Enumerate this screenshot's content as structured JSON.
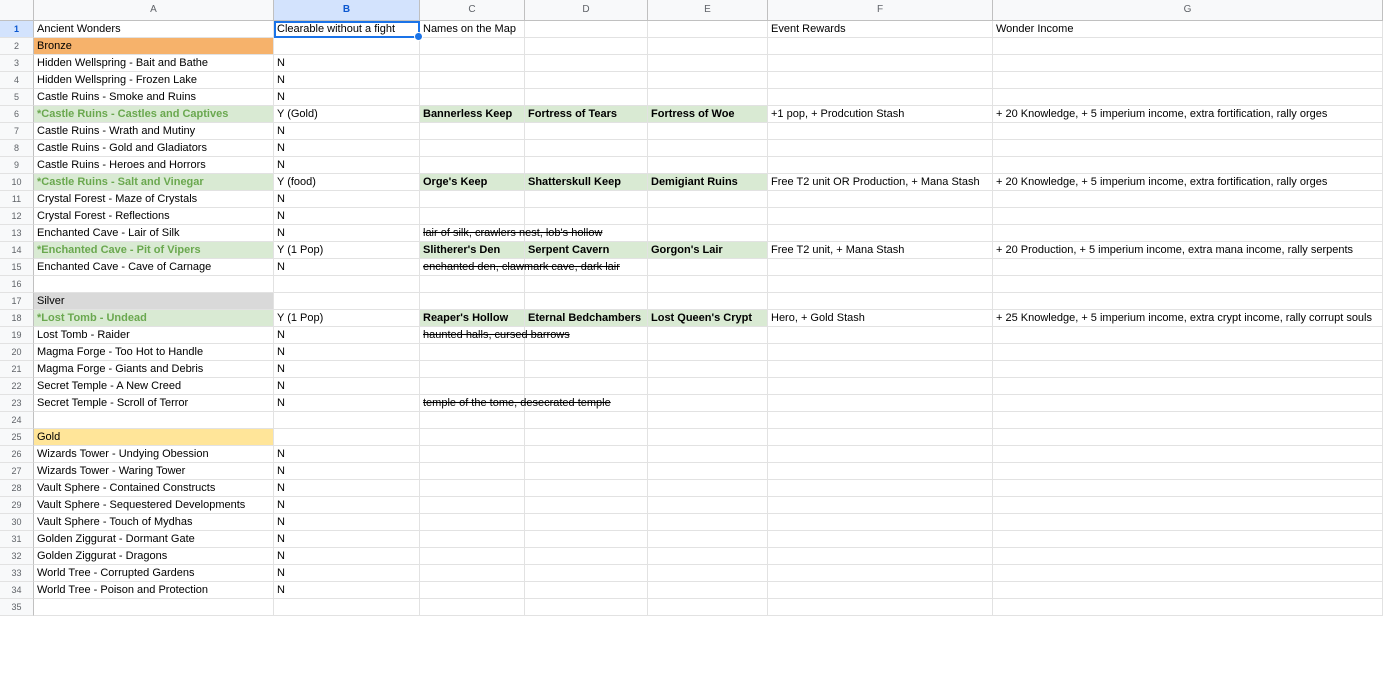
{
  "columns": [
    "A",
    "B",
    "C",
    "D",
    "E",
    "F",
    "G"
  ],
  "selected_column": "B",
  "selected_row": "1",
  "rows": [
    {
      "n": "1",
      "a": "Ancient Wonders",
      "b": "Clearable without a fight",
      "c": "Names on the Map",
      "d": "",
      "e": "",
      "f": "Event Rewards",
      "g": "Wonder Income"
    },
    {
      "n": "2",
      "a": "Bronze",
      "b": "",
      "c": "",
      "d": "",
      "e": "",
      "f": "",
      "g": ""
    },
    {
      "n": "3",
      "a": "Hidden Wellspring - Bait and Bathe",
      "b": "N",
      "c": "",
      "d": "",
      "e": "",
      "f": "",
      "g": ""
    },
    {
      "n": "4",
      "a": "Hidden Wellspring - Frozen Lake",
      "b": "N",
      "c": "",
      "d": "",
      "e": "",
      "f": "",
      "g": ""
    },
    {
      "n": "5",
      "a": "Castle Ruins - Smoke and Ruins",
      "b": "N",
      "c": "",
      "d": "",
      "e": "",
      "f": "",
      "g": ""
    },
    {
      "n": "6",
      "a": "*Castle Ruins - Castles and Captives",
      "b": "Y (Gold)",
      "c": "Bannerless Keep",
      "d": "Fortress of Tears",
      "e": "Fortress of Woe",
      "f": "+1 pop, + Prodcution Stash",
      "g": "+ 20 Knowledge, + 5 imperium income, extra fortification, rally orges"
    },
    {
      "n": "7",
      "a": "Castle Ruins - Wrath and Mutiny",
      "b": "N",
      "c": "",
      "d": "",
      "e": "",
      "f": "",
      "g": ""
    },
    {
      "n": "8",
      "a": "Castle Ruins - Gold and Gladiators",
      "b": "N",
      "c": "",
      "d": "",
      "e": "",
      "f": "",
      "g": ""
    },
    {
      "n": "9",
      "a": "Castle Ruins - Heroes and Horrors",
      "b": "N",
      "c": "",
      "d": "",
      "e": "",
      "f": "",
      "g": ""
    },
    {
      "n": "10",
      "a": "*Castle Ruins - Salt and Vinegar",
      "b": "Y (food)",
      "c": "Orge's Keep",
      "d": "Shatterskull Keep",
      "e": "Demigiant Ruins",
      "f": "Free T2 unit OR Production, + Mana Stash",
      "g": "+ 20 Knowledge, + 5 imperium income, extra fortification, rally orges"
    },
    {
      "n": "11",
      "a": "Crystal Forest - Maze of Crystals",
      "b": "N",
      "c": "",
      "d": "",
      "e": "",
      "f": "",
      "g": ""
    },
    {
      "n": "12",
      "a": "Crystal Forest - Reflections",
      "b": "N",
      "c": "",
      "d": "",
      "e": "",
      "f": "",
      "g": ""
    },
    {
      "n": "13",
      "a": "Enchanted Cave - Lair of Silk",
      "b": "N",
      "c": "lair of silk, crawlers nest, lob's hollow",
      "d": "",
      "e": "",
      "f": "",
      "g": ""
    },
    {
      "n": "14",
      "a": "*Enchanted Cave - Pit of Vipers",
      "b": "Y (1 Pop)",
      "c": "Slitherer's Den",
      "d": "Serpent Cavern",
      "e": "Gorgon's Lair",
      "f": "Free T2 unit, + Mana Stash",
      "g": "+ 20 Production, + 5 imperium income, extra mana income, rally serpents"
    },
    {
      "n": "15",
      "a": "Enchanted Cave - Cave of Carnage",
      "b": "N",
      "c": "enchanted den, clawmark cave, dark lair",
      "d": "",
      "e": "",
      "f": "",
      "g": ""
    },
    {
      "n": "16",
      "a": "",
      "b": "",
      "c": "",
      "d": "",
      "e": "",
      "f": "",
      "g": ""
    },
    {
      "n": "17",
      "a": "Silver",
      "b": "",
      "c": "",
      "d": "",
      "e": "",
      "f": "",
      "g": ""
    },
    {
      "n": "18",
      "a": "*Lost Tomb - Undead",
      "b": "Y (1 Pop)",
      "c": "Reaper's Hollow",
      "d": "Eternal Bedchambers",
      "e": "Lost Queen's Crypt",
      "f": "Hero, + Gold Stash",
      "g": "+ 25 Knowledge, + 5 imperium income, extra crypt income, rally corrupt souls"
    },
    {
      "n": "19",
      "a": "Lost Tomb - Raider",
      "b": "N",
      "c": "haunted halls, cursed barrows",
      "d": "",
      "e": "",
      "f": "",
      "g": ""
    },
    {
      "n": "20",
      "a": "Magma Forge - Too Hot to Handle",
      "b": "N",
      "c": "",
      "d": "",
      "e": "",
      "f": "",
      "g": ""
    },
    {
      "n": "21",
      "a": "Magma Forge - Giants and Debris",
      "b": "N",
      "c": "",
      "d": "",
      "e": "",
      "f": "",
      "g": ""
    },
    {
      "n": "22",
      "a": "Secret Temple - A New Creed",
      "b": "N",
      "c": "",
      "d": "",
      "e": "",
      "f": "",
      "g": ""
    },
    {
      "n": "23",
      "a": "Secret Temple - Scroll of Terror",
      "b": "N",
      "c": "temple of the tome, desecrated temple",
      "d": "",
      "e": "",
      "f": "",
      "g": ""
    },
    {
      "n": "24",
      "a": "",
      "b": "",
      "c": "",
      "d": "",
      "e": "",
      "f": "",
      "g": ""
    },
    {
      "n": "25",
      "a": "Gold",
      "b": "",
      "c": "",
      "d": "",
      "e": "",
      "f": "",
      "g": ""
    },
    {
      "n": "26",
      "a": "Wizards Tower - Undying Obession",
      "b": "N",
      "c": "",
      "d": "",
      "e": "",
      "f": "",
      "g": ""
    },
    {
      "n": "27",
      "a": "Wizards Tower - Waring Tower",
      "b": "N",
      "c": "",
      "d": "",
      "e": "",
      "f": "",
      "g": ""
    },
    {
      "n": "28",
      "a": "Vault Sphere - Contained Constructs",
      "b": "N",
      "c": "",
      "d": "",
      "e": "",
      "f": "",
      "g": ""
    },
    {
      "n": "29",
      "a": "Vault Sphere - Sequestered Developments",
      "b": "N",
      "c": "",
      "d": "",
      "e": "",
      "f": "",
      "g": ""
    },
    {
      "n": "30",
      "a": "Vault Sphere - Touch of Mydhas",
      "b": "N",
      "c": "",
      "d": "",
      "e": "",
      "f": "",
      "g": ""
    },
    {
      "n": "31",
      "a": "Golden Ziggurat - Dormant Gate",
      "b": "N",
      "c": "",
      "d": "",
      "e": "",
      "f": "",
      "g": ""
    },
    {
      "n": "32",
      "a": "Golden Ziggurat - Dragons",
      "b": "N",
      "c": "",
      "d": "",
      "e": "",
      "f": "",
      "g": ""
    },
    {
      "n": "33",
      "a": "World Tree - Corrupted Gardens",
      "b": "N",
      "c": "",
      "d": "",
      "e": "",
      "f": "",
      "g": ""
    },
    {
      "n": "34",
      "a": "World Tree - Poison and Protection",
      "b": "N",
      "c": "",
      "d": "",
      "e": "",
      "f": "",
      "g": ""
    },
    {
      "n": "35",
      "a": "",
      "b": "",
      "c": "",
      "d": "",
      "e": "",
      "f": "",
      "g": ""
    }
  ],
  "colors": {
    "bronze_fill": "#f6b26b",
    "silver_fill": "#d9d9d9",
    "gold_fill": "#ffe599",
    "highlight_fill": "#d9ead3",
    "highlight_text": "#6aa84f",
    "selection": "#1a73e8"
  }
}
